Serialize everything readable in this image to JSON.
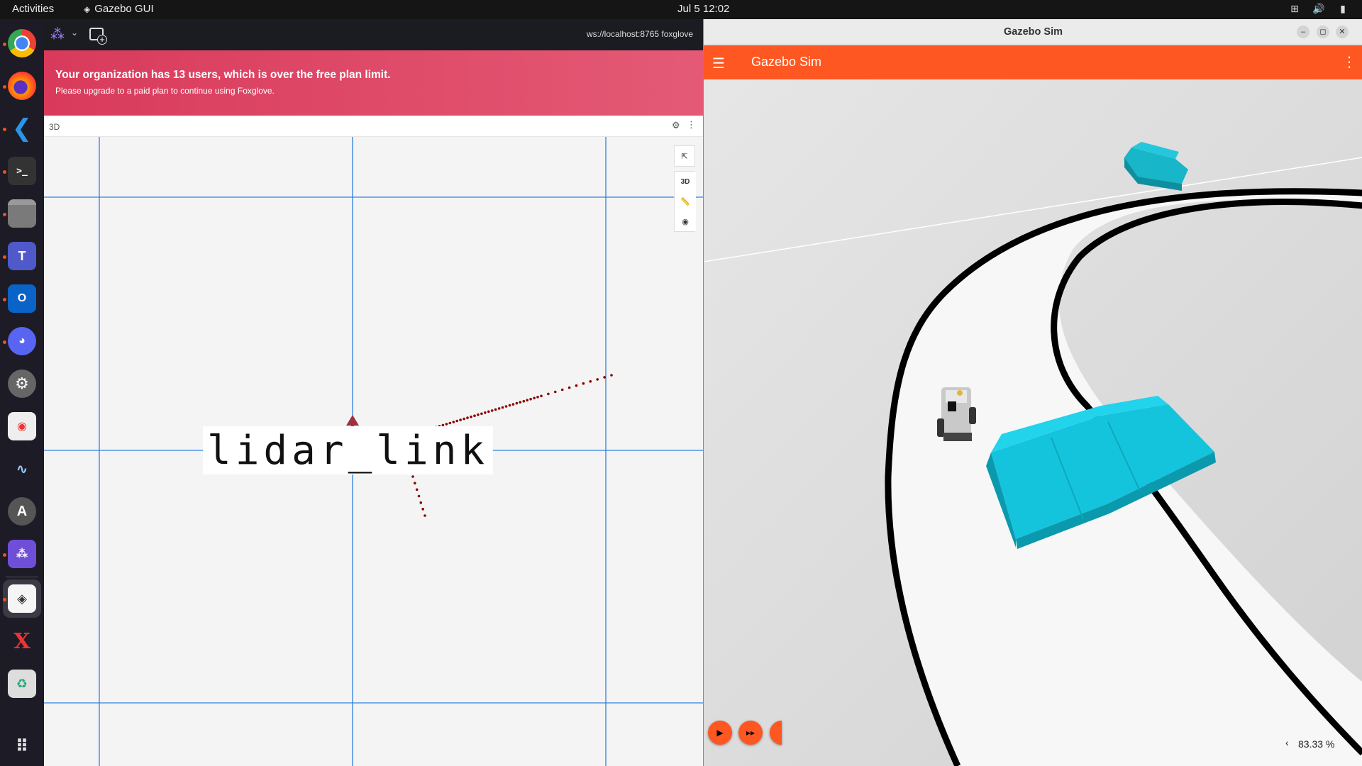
{
  "topbar": {
    "activities": "Activities",
    "app_name": "Gazebo GUI",
    "clock": "Jul 5  12:02",
    "tray_icons": [
      "network-icon",
      "volume-icon",
      "battery-icon"
    ]
  },
  "dock": {
    "apps": [
      "chrome",
      "firefox",
      "vscode",
      "terminal",
      "files",
      "teams",
      "outlook",
      "discord",
      "settings",
      "tweaks",
      "system-monitor",
      "software",
      "foxglove",
      "gazebo",
      "xserver",
      "trash",
      "show-apps"
    ]
  },
  "foxglove": {
    "connection_url": "ws://localhost:8765 foxglove",
    "banner": {
      "title": "Your organization has 13 users, which is over the free plan limit.",
      "subtitle": "Please upgrade to a paid plan to continue using Foxglove."
    },
    "panel": {
      "title": "3D",
      "tools": {
        "mode_label": "3D"
      }
    },
    "scene": {
      "frame_label": "lidar_link",
      "pointcloud_color": "#8b0000",
      "grid_color": "#2f7fe0"
    }
  },
  "gazebo": {
    "window_title": "Gazebo Sim",
    "app_title": "Gazebo Sim",
    "accent": "#ff5722",
    "real_time_factor": "83.33 %"
  }
}
